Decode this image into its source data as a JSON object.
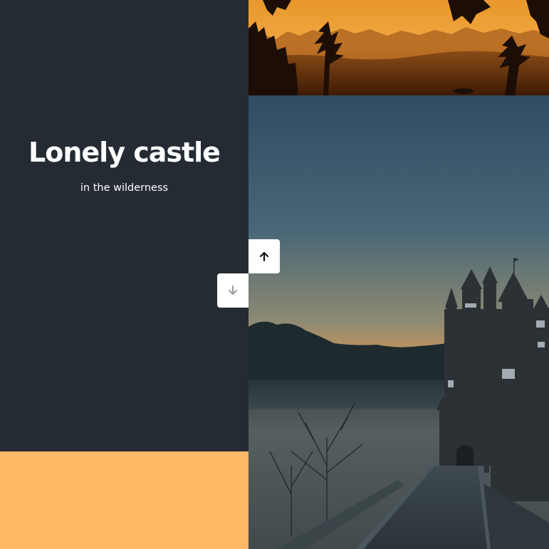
{
  "slide": {
    "title": "Lonely castle",
    "subtitle": "in the wilderness"
  },
  "images": {
    "top": "sunset-forest-photo",
    "main": "castle-in-fog-photo"
  },
  "controls": {
    "up_icon": "arrow-up-icon",
    "down_icon": "arrow-down-icon"
  },
  "colors": {
    "text_panel_bg": "#252b33",
    "next_panel_bg": "#ffb866",
    "button_bg": "#ffffff",
    "up_arrow": "#111111",
    "down_arrow": "#9aa0a6"
  }
}
